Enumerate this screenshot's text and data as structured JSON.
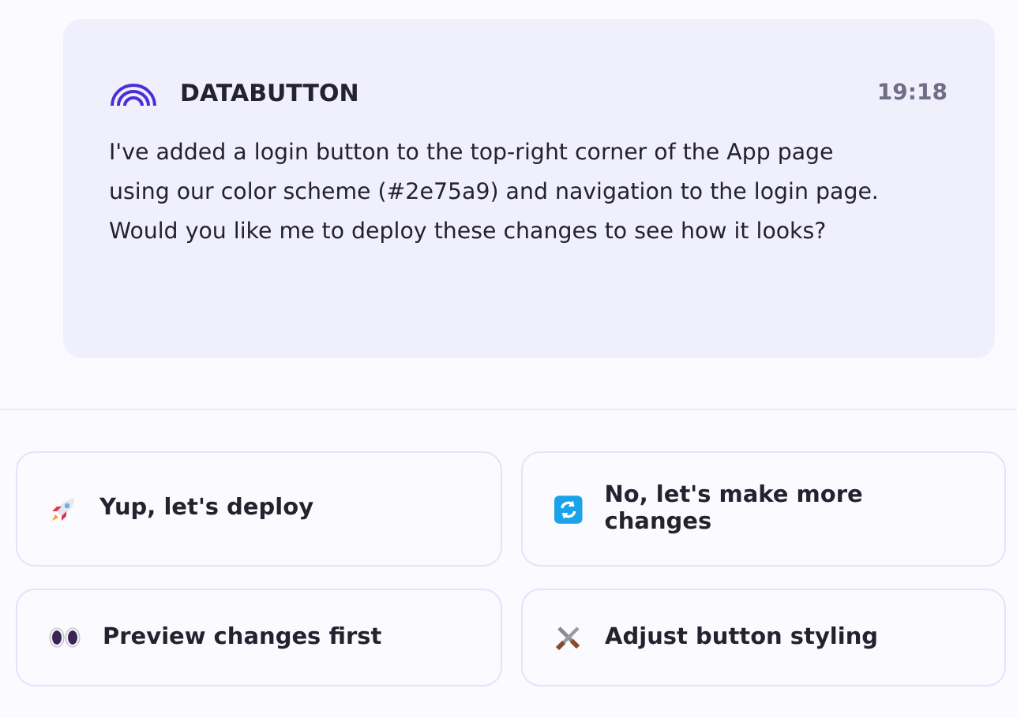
{
  "message": {
    "sender": "DATABUTTON",
    "time": "19:18",
    "text": "I've added a login button to the top-right corner of the App page using our color scheme (#2e75a9) and navigation to the login page. Would you like me to deploy these changes to see how it looks?"
  },
  "suggestions": [
    {
      "kind": "rocket",
      "label": "Yup, let's deploy"
    },
    {
      "kind": "refresh",
      "label": "No, let's make more changes"
    },
    {
      "kind": "eyes",
      "label": "Preview changes first"
    },
    {
      "kind": "tools",
      "label": "Adjust button styling"
    }
  ]
}
